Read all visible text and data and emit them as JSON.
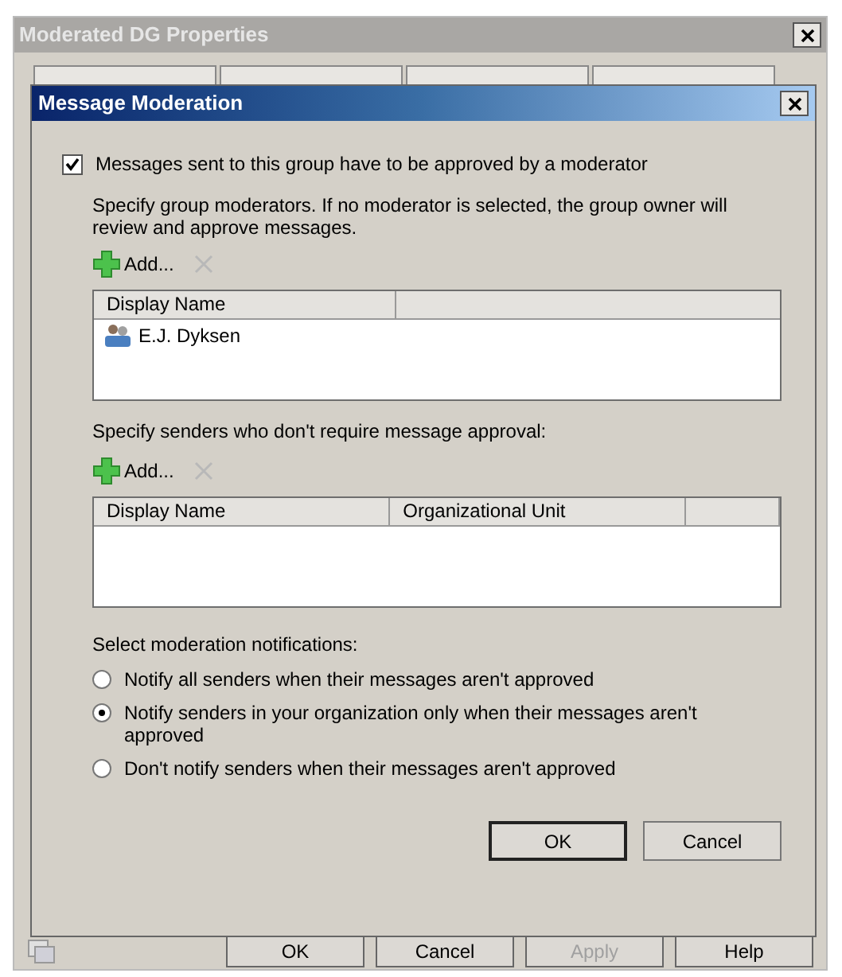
{
  "outer_window": {
    "title": "Moderated DG Properties",
    "buttons": [
      {
        "label": "OK",
        "disabled": false
      },
      {
        "label": "Cancel",
        "disabled": false
      },
      {
        "label": "Apply",
        "disabled": true
      },
      {
        "label": "Help",
        "disabled": false
      }
    ]
  },
  "dialog": {
    "title": "Message Moderation",
    "moderation_required": {
      "label": "Messages sent to this group have to be approved by a moderator",
      "checked": true
    },
    "moderators": {
      "description": "Specify group moderators. If no moderator is selected, the group owner will review and approve messages.",
      "add_label": "Add...",
      "columns": [
        "Display Name"
      ],
      "rows": [
        {
          "display_name": "E.J. Dyksen"
        }
      ]
    },
    "bypass": {
      "description": "Specify senders who don't require message approval:",
      "add_label": "Add...",
      "columns": [
        "Display Name",
        "Organizational Unit"
      ]
    },
    "notifications": {
      "label": "Select moderation notifications:",
      "options": [
        {
          "label": "Notify all senders when their messages aren't approved",
          "selected": false
        },
        {
          "label": "Notify senders in your organization only when their messages aren't approved",
          "selected": true
        },
        {
          "label": "Don't notify senders when their messages aren't approved",
          "selected": false
        }
      ]
    },
    "buttons": [
      "OK",
      "Cancel"
    ]
  }
}
